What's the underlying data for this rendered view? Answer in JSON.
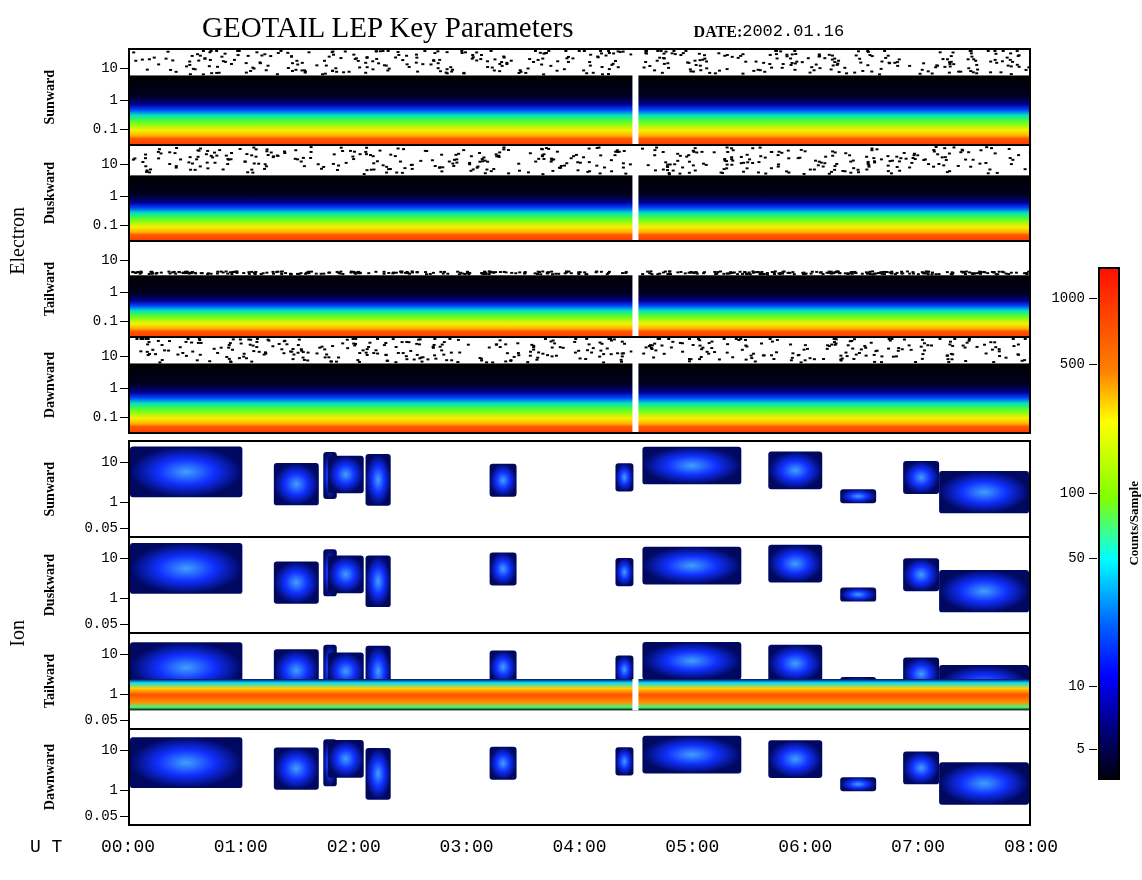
{
  "title": "GEOTAIL LEP Key Parameters",
  "date": {
    "label": "DATE:",
    "value": "2002.01.16"
  },
  "groups": [
    {
      "name": "Electron",
      "kind": "electron",
      "panels": [
        {
          "name": "Sunward",
          "yticks": [
            "10",
            "1",
            "0.1"
          ]
        },
        {
          "name": "Duskward",
          "yticks": [
            "10",
            "1",
            "0.1"
          ]
        },
        {
          "name": "Tailward",
          "yticks": [
            "10",
            "1",
            "0.1"
          ]
        },
        {
          "name": "Dawnward",
          "yticks": [
            "10",
            "1",
            "0.1"
          ]
        }
      ]
    },
    {
      "name": "Ion",
      "kind": "ion",
      "panels": [
        {
          "name": "Sunward",
          "yticks": [
            "10",
            "1",
            "0.05"
          ]
        },
        {
          "name": "Duskward",
          "yticks": [
            "10",
            "1",
            "0.05"
          ]
        },
        {
          "name": "Tailward",
          "yticks": [
            "10",
            "1",
            "0.05"
          ]
        },
        {
          "name": "Dawnward",
          "yticks": [
            "10",
            "1",
            "0.05"
          ]
        }
      ]
    }
  ],
  "colorbar": {
    "label": "Counts/Sample",
    "ticks": [
      "1000",
      "500",
      "100",
      "50",
      "10",
      "5"
    ]
  },
  "xaxis": {
    "label": "U T",
    "ticks": [
      "00:00",
      "01:00",
      "02:00",
      "03:00",
      "04:00",
      "05:00",
      "06:00",
      "07:00",
      "08:00"
    ]
  }
}
